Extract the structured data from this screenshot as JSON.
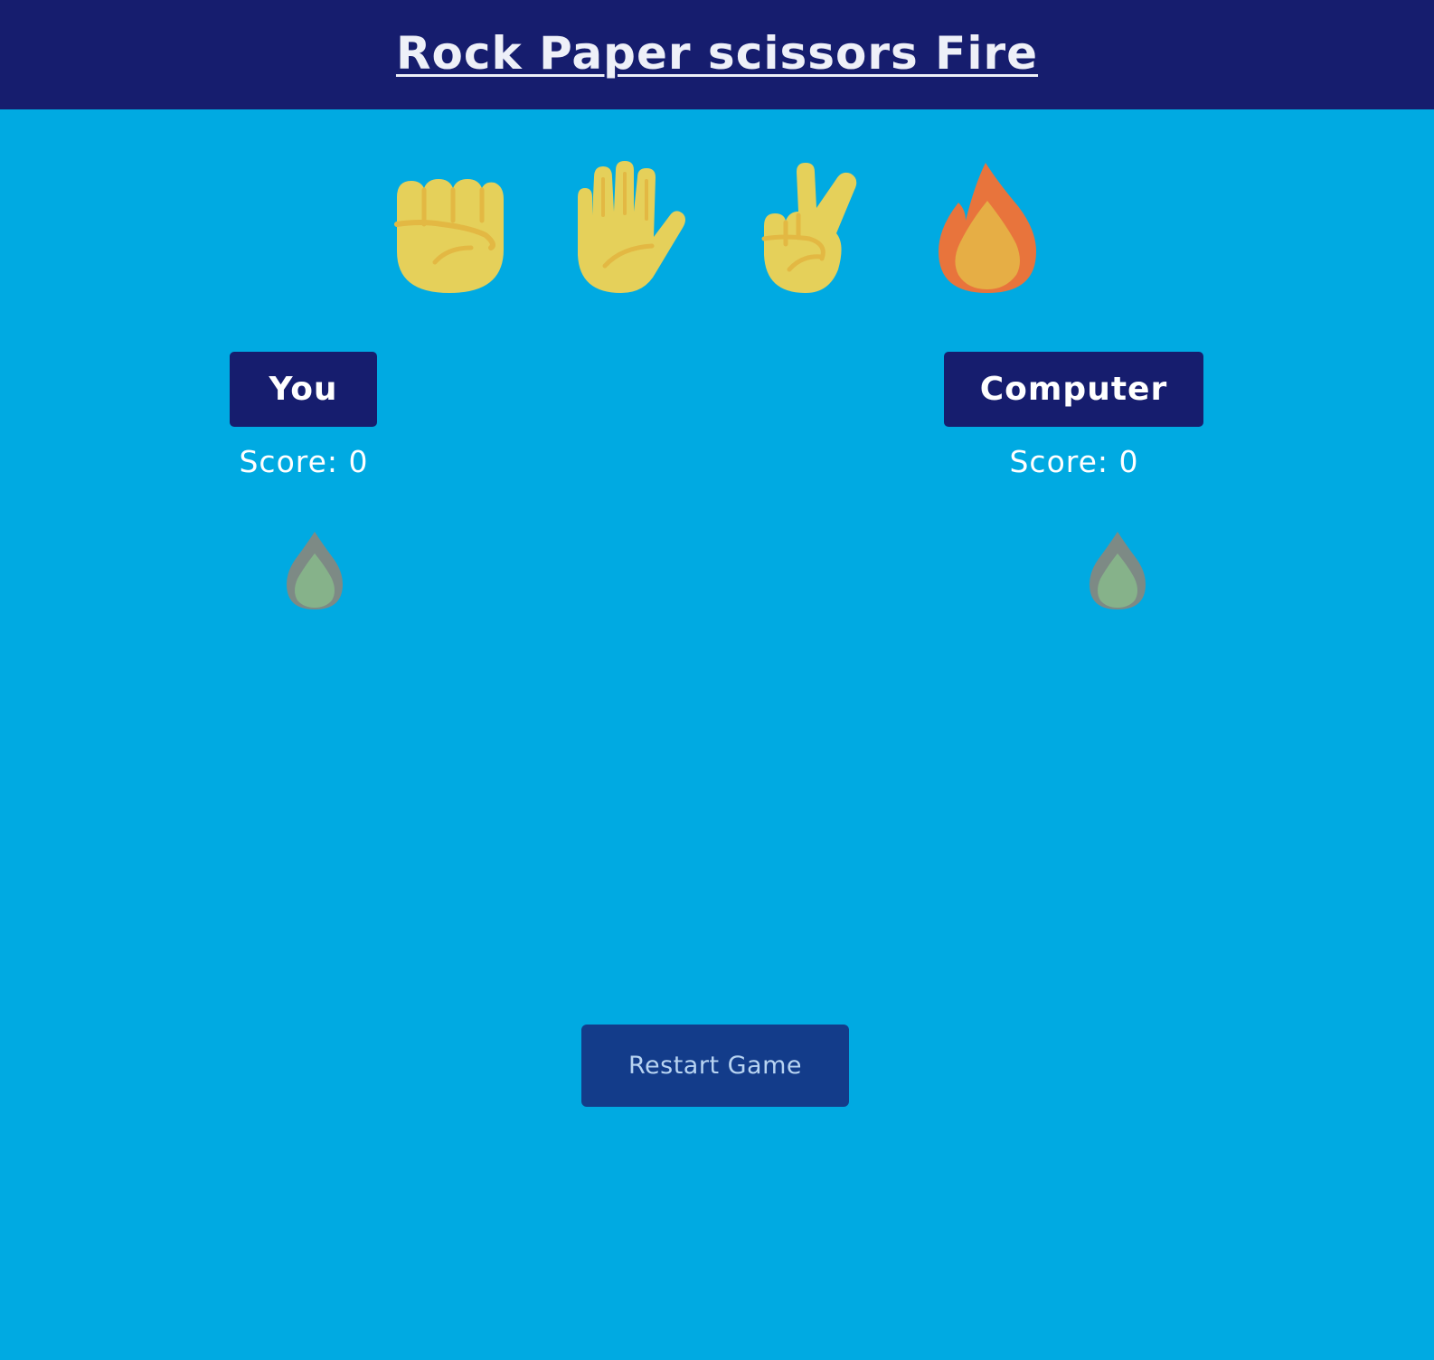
{
  "header": {
    "title": "Rock Paper scissors Fire"
  },
  "choices": [
    {
      "icon": "raised-fist-icon"
    },
    {
      "icon": "raised-hand-icon"
    },
    {
      "icon": "victory-hand-icon"
    },
    {
      "icon": "fire-icon"
    }
  ],
  "players": {
    "you": {
      "label": "You",
      "score_text": "Score: 0",
      "selection_icon": "fire-icon"
    },
    "computer": {
      "label": "Computer",
      "score_text": "Score: 0",
      "selection_icon": "fire-icon"
    }
  },
  "controls": {
    "restart_label": "Restart Game"
  },
  "colors": {
    "background": "#00aae2",
    "header": "#161d6e",
    "player_tag": "#161d6e",
    "restart_button": "#133c8a",
    "emoji_yellow": "#e5d05a",
    "fire_orange": "#e8743c",
    "selection_grey": "#7d8a85",
    "selection_green": "#86b28a"
  }
}
